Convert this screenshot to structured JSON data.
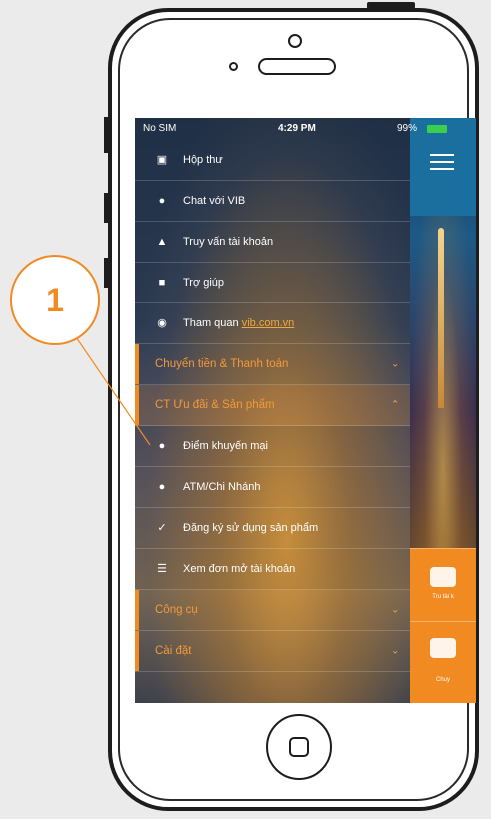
{
  "status_bar": {
    "carrier": "No SIM",
    "time": "4:29 PM",
    "battery": "99%"
  },
  "menu": {
    "items": [
      {
        "label": "Hộp thư",
        "icon": "inbox-icon"
      },
      {
        "label": "Chat với VIB",
        "icon": "chat-icon"
      },
      {
        "label": "Truy vấn tài khoản",
        "icon": "user-icon"
      },
      {
        "label": "Trợ giúp",
        "icon": "help-icon"
      },
      {
        "label": "Tham quan ",
        "link": "vib.com.vn",
        "icon": "globe-icon"
      }
    ],
    "sections": [
      {
        "label": "Chuyển tiền & Thanh toán",
        "expanded": false
      },
      {
        "label": "CT Ưu đãi & Sản phẩm",
        "expanded": true
      },
      {
        "label": "Công cụ",
        "expanded": false
      },
      {
        "label": "Cài đặt",
        "expanded": false
      }
    ],
    "sub_items": [
      {
        "label": "Điểm khuyến mại",
        "icon": "location-pin-icon"
      },
      {
        "label": "ATM/Chi Nhánh",
        "icon": "location-pin-icon"
      },
      {
        "label": "Đăng ký sử dụng sản phẩm",
        "icon": "check-icon"
      },
      {
        "label": "Xem đơn mở tài khoản",
        "icon": "document-list-icon"
      }
    ]
  },
  "background_tiles": [
    {
      "label": "Tru tài k"
    },
    {
      "label": "Chuy"
    }
  ],
  "callout": {
    "number": "1"
  },
  "colors": {
    "accent": "#f28a22",
    "link": "#f0a93c",
    "menu_text": "#ffffff"
  }
}
